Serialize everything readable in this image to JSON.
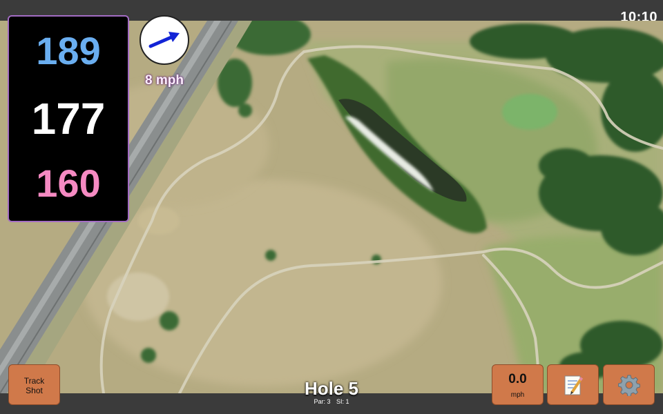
{
  "status_bar": {
    "time": "10:10"
  },
  "distances": {
    "back": "189",
    "middle": "177",
    "front": "160"
  },
  "wind": {
    "speed_value": "8",
    "speed_unit": "mph",
    "direction_icon": "arrow-right-icon"
  },
  "buttons": {
    "track_shot_line1": "Track",
    "track_shot_line2": "Shot",
    "speed_value": "0.0",
    "speed_unit": "mph",
    "notes_icon": "memo-icon",
    "settings_icon": "gear-icon"
  },
  "hole": {
    "title": "Hole 5",
    "par": "Par: 3",
    "si": "SI: 1"
  },
  "colors": {
    "back_distance": "#6aaef0",
    "middle_distance": "#ffffff",
    "front_distance": "#f58ac2",
    "button": "#d0794a",
    "accent_border": "#a36cc4"
  }
}
